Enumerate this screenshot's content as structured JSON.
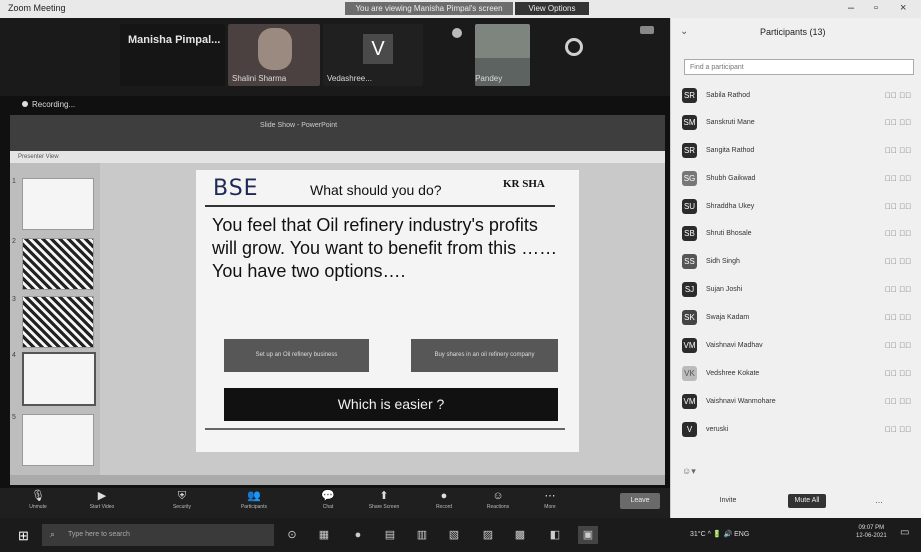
{
  "window": {
    "title": "Zoom Meeting",
    "share_banner": "You are viewing Manisha Pimpal's screen",
    "view_options": "View Options",
    "minimize": "–",
    "maximize": "▫",
    "close": "×"
  },
  "video_strip": {
    "tile1_name": "Manisha Pimpal...",
    "tile2_name": "Shalini Sharma",
    "tile3_initial": "V",
    "tile3_name": "Vedashree...",
    "tile4_name": "Ayushi Pandey",
    "recording_label": "Recording..."
  },
  "ppt": {
    "window_title": "Slide Show - PowerPoint",
    "address_bar": "Presenter View",
    "slide_numbers": [
      "1",
      "2",
      "3",
      "4",
      "5"
    ]
  },
  "slide": {
    "logo_text": "BSE",
    "title": "What should you do?",
    "brand_text": "KR SHA",
    "body": "You feel that Oil refinery industry's profits will grow. You want to benefit from this …… You have two options….",
    "option1": "Set up an Oil refinery business",
    "option2": "Buy shares in an oil refinery company",
    "question": "Which is easier ?"
  },
  "toolbar": {
    "items": [
      {
        "icon": "mic-icon",
        "glyph": "🎙",
        "label": "Unmute"
      },
      {
        "icon": "video-icon",
        "glyph": "▶",
        "label": "Start Video"
      },
      {
        "icon": "security-icon",
        "glyph": "⛨",
        "label": "Security"
      },
      {
        "icon": "participants-icon",
        "glyph": "👥",
        "label": "Participants"
      },
      {
        "icon": "chat-icon",
        "glyph": "💬",
        "label": "Chat"
      },
      {
        "icon": "share-icon",
        "glyph": "⬆",
        "label": "Share Screen"
      },
      {
        "icon": "record-icon",
        "glyph": "●",
        "label": "Record"
      },
      {
        "icon": "reactions-icon",
        "glyph": "☺",
        "label": "Reactions"
      },
      {
        "icon": "more-icon",
        "glyph": "⋯",
        "label": "More"
      }
    ],
    "leave_label": "Leave"
  },
  "participants": {
    "title": "Participants (13)",
    "search_placeholder": "Find a participant",
    "list": [
      {
        "initial": "SR",
        "name": "Sabila Rathod"
      },
      {
        "initial": "SM",
        "name": "Sanskruti Mane"
      },
      {
        "initial": "SR",
        "name": "Sangita Rathod"
      },
      {
        "initial": "SG",
        "name": "Shubh Gaikwad"
      },
      {
        "initial": "SU",
        "name": "Shraddha Ukey"
      },
      {
        "initial": "SB",
        "name": "Shruti Bhosale"
      },
      {
        "initial": "SS",
        "name": "Sidh Singh"
      },
      {
        "initial": "SJ",
        "name": "Sujan Joshi"
      },
      {
        "initial": "SK",
        "name": "Swaja Kadam"
      },
      {
        "initial": "VM",
        "name": "Vaishnavi Madhav"
      },
      {
        "initial": "VK",
        "name": "Vedshree Kokate"
      },
      {
        "initial": "VM",
        "name": "Vaishnavi Wanmohare"
      },
      {
        "initial": "V",
        "name": "veruski"
      }
    ],
    "row_status": "🎤⃠ 📷⃠",
    "invite_label": "Invite",
    "mute_all_label": "Mute All",
    "more_label": "…"
  },
  "taskbar": {
    "search_placeholder": "Type here to search",
    "apps": [
      "⊙",
      "▦",
      "●",
      "▤",
      "▥",
      "▧",
      "▨",
      "▩",
      "◧"
    ],
    "tray": "31°C  ^  🔋  🔊  ENG",
    "time": "09:07 PM",
    "date": "12-06-2021"
  }
}
